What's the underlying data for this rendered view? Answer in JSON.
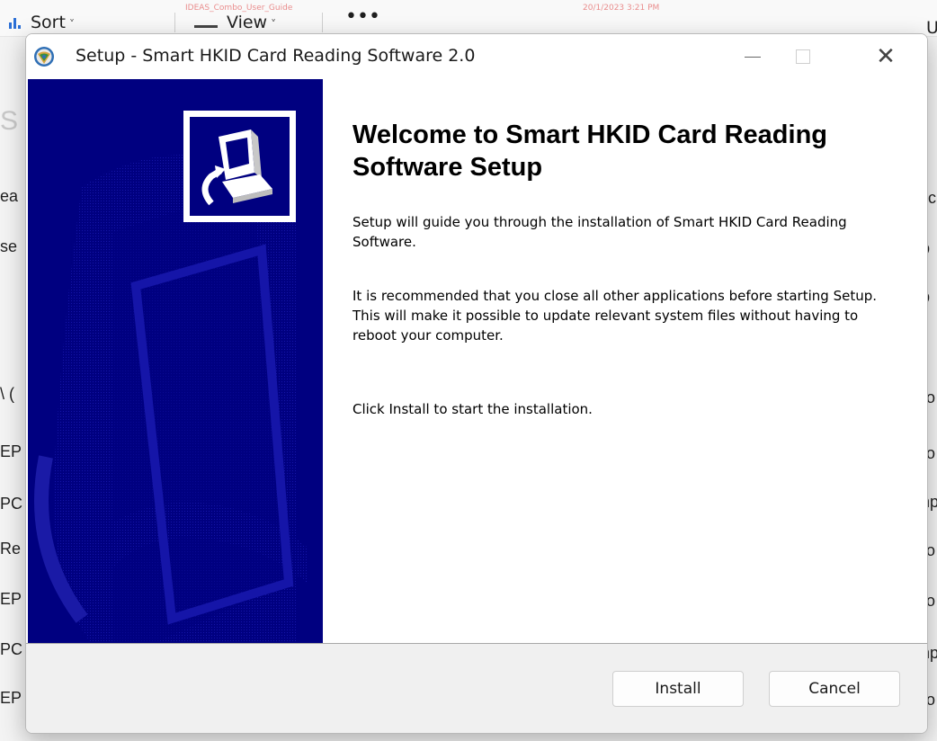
{
  "background_window": {
    "toolbar": {
      "sort_label": "Sort",
      "view_label": "View",
      "more_label": "•••",
      "faded_tab_text": "IDEAS_Combo_User_Guide",
      "faded_date_text": "20/1/2023 3:21 PM",
      "right_edge_text": "U"
    },
    "left_column_fragments": [
      "ea",
      "se",
      "\\ (",
      "EP",
      "PC",
      "Re",
      "EP",
      "PC",
      "EP"
    ],
    "right_column_fragments": [
      "e",
      "lic",
      "b",
      "b",
      "ro",
      "ro",
      "np",
      "ro",
      "ro",
      "np",
      "ro"
    ],
    "faint_left_glyph": "S"
  },
  "dialog": {
    "title": "Setup - Smart HKID Card Reading Software 2.0",
    "heading": "Welcome to Smart HKID Card Reading Software Setup",
    "paragraphs": [
      "Setup will guide you through the installation of Smart HKID Card Reading Software.",
      "It is recommended that you close all other applications before starting Setup. This will make it possible to update relevant system files without having to reboot your computer.",
      "Click Install to start the installation."
    ],
    "buttons": {
      "install": "Install",
      "cancel": "Cancel"
    },
    "window_controls": {
      "minimize": "—",
      "close": "✕"
    },
    "colors": {
      "side_panel": "#000080",
      "side_panel_accent": "#1a1aa6"
    }
  }
}
